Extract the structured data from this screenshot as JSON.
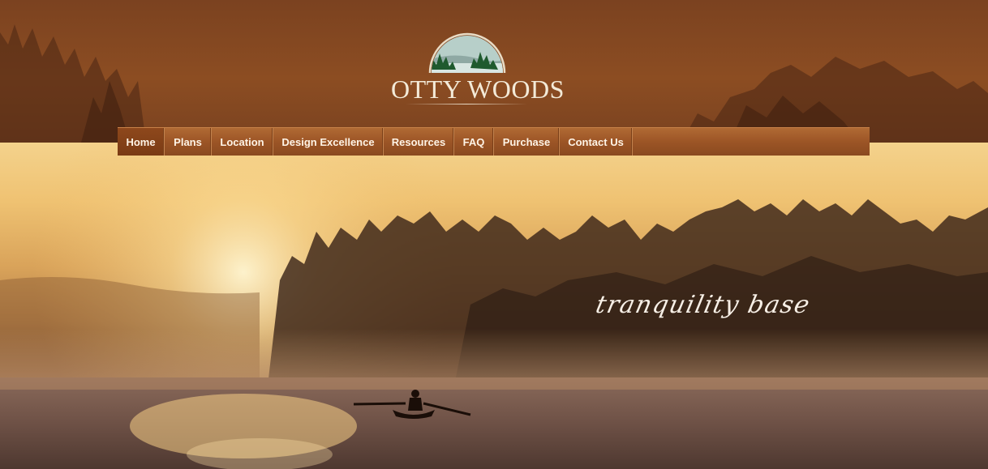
{
  "brand": {
    "logo_text_first": "OTTY",
    "logo_text_second": "WOODS",
    "logo_icon": "lake-trees-logo"
  },
  "nav": {
    "items": [
      {
        "label": "Home",
        "active": true
      },
      {
        "label": "Plans"
      },
      {
        "label": "Location"
      },
      {
        "label": "Design Excellence"
      },
      {
        "label": "Resources"
      },
      {
        "label": "FAQ"
      },
      {
        "label": "Purchase"
      },
      {
        "label": "Contact Us"
      }
    ]
  },
  "hero": {
    "tagline": "tranquility base"
  },
  "colors": {
    "header": "#8c4d22",
    "nav": "#9c5526",
    "nav_active": "#7a3b14",
    "text_light": "#f7efe6"
  }
}
